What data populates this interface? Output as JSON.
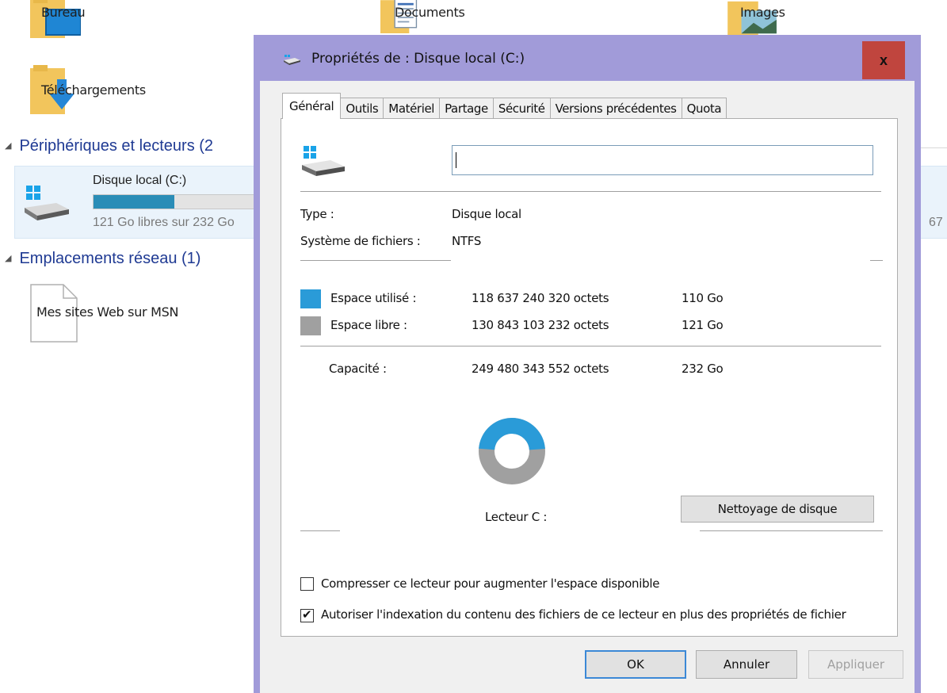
{
  "explorer": {
    "folders": [
      {
        "label": "Bureau",
        "icon": "desktop-folder-icon"
      },
      {
        "label": "Documents",
        "icon": "documents-folder-icon"
      },
      {
        "label": "Images",
        "icon": "pictures-folder-icon"
      },
      {
        "label": "Téléchargements",
        "icon": "downloads-folder-icon"
      }
    ],
    "devices_header": "Périphériques et lecteurs (2",
    "drive": {
      "name": "Disque local (C:)",
      "free_text": "121 Go libres sur 232 Go",
      "used_fraction": 0.48,
      "right_text": "67"
    },
    "network_header": "Emplacements réseau (1)",
    "network_item": "Mes sites Web sur MSN"
  },
  "dialog": {
    "title": "Propriétés de : Disque local (C:)",
    "close_label": "x",
    "tabs": [
      {
        "label": "Général",
        "active": true
      },
      {
        "label": "Outils"
      },
      {
        "label": "Matériel"
      },
      {
        "label": "Partage"
      },
      {
        "label": "Sécurité"
      },
      {
        "label": "Versions précédentes"
      },
      {
        "label": "Quota"
      }
    ],
    "name_value": "",
    "type_label": "Type :",
    "type_value": "Disque local",
    "fs_label": "Système de fichiers :",
    "fs_value": "NTFS",
    "used": {
      "label": "Espace utilisé :",
      "bytes": "118 637 240 320 octets",
      "size": "110 Go",
      "color": "#2a9bd8"
    },
    "free": {
      "label": "Espace libre :",
      "bytes": "130 843 103 232 octets",
      "size": "121 Go",
      "color": "#a0a0a0"
    },
    "capacity": {
      "label": "Capacité :",
      "bytes": "249 480 343 552 octets",
      "size": "232 Go"
    },
    "used_fraction": 0.4755,
    "drive_label": "Lecteur C :",
    "cleanup_button": "Nettoyage de disque",
    "compress": {
      "label": "Compresser ce lecteur pour augmenter l'espace disponible",
      "checked": false
    },
    "index": {
      "label": "Autoriser l'indexation du contenu des fichiers de ce lecteur en plus des propriétés de fichier",
      "checked": true
    },
    "buttons": {
      "ok": "OK",
      "cancel": "Annuler",
      "apply": "Appliquer"
    }
  }
}
